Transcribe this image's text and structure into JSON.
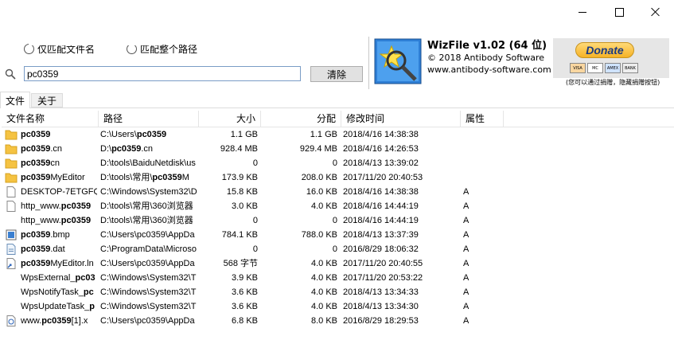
{
  "window": {
    "controls": {
      "minimize": "minimize",
      "maximize": "maximize",
      "close": "close"
    }
  },
  "search": {
    "radio_other": "仅匹配文件名",
    "radio_fullpath": "匹配整个路径",
    "query": "pc0359",
    "clear_label": "清除"
  },
  "app": {
    "title": "WizFile v1.02 (64 位)",
    "copyright": "© 2018 Antibody Software",
    "website": "www.antibody-software.com"
  },
  "donate": {
    "label": "Donate",
    "cards": [
      "VISA",
      "MC",
      "AMEX",
      "BANK"
    ],
    "note": "(您可以通过捐赠，隐藏捐赠按钮)"
  },
  "tabs": [
    {
      "label": "文件"
    },
    {
      "label": "关于"
    }
  ],
  "columns": {
    "name": "文件名称",
    "path": "路径",
    "size": "大小",
    "alloc": "分配",
    "modified": "修改时间",
    "attr": "属性"
  },
  "rows": [
    {
      "icon": "folder",
      "name_hl": "pc0359",
      "name_rest": "",
      "path_pre": "C:\\Users\\",
      "path_hl": "pc0359",
      "path_rest": "",
      "size": "1.1 GB",
      "alloc": "1.1 GB",
      "modified": "2018/4/16 14:38:38",
      "attr": ""
    },
    {
      "icon": "folder",
      "name_hl": "pc0359",
      "name_rest": ".cn",
      "path_pre": "D:\\",
      "path_hl": "pc0359",
      "path_rest": ".cn",
      "size": "928.4 MB",
      "alloc": "929.4 MB",
      "modified": "2018/4/16 14:26:53",
      "attr": ""
    },
    {
      "icon": "folder",
      "name_hl": "pc0359",
      "name_rest": "cn",
      "path_pre": "D:\\tools\\BaiduNetdisk\\us",
      "path_hl": "",
      "path_rest": "",
      "size": "0",
      "alloc": "0",
      "modified": "2018/4/13 13:39:02",
      "attr": ""
    },
    {
      "icon": "folder",
      "name_hl": "pc0359",
      "name_rest": "MyEditor",
      "path_pre": "D:\\tools\\常用\\",
      "path_hl": "pc0359",
      "path_rest": "M",
      "size": "173.9 KB",
      "alloc": "208.0 KB",
      "modified": "2017/11/20 20:40:53",
      "attr": ""
    },
    {
      "icon": "doc",
      "name_hl": "",
      "name_rest": "DESKTOP-7ETGFQH",
      "path_pre": "C:\\Windows\\System32\\D",
      "path_hl": "",
      "path_rest": "",
      "size": "15.8 KB",
      "alloc": "16.0 KB",
      "modified": "2018/4/16 14:38:38",
      "attr": "A"
    },
    {
      "icon": "doc",
      "name_hl": "pc0359",
      "name_rest": "",
      "name_pre": "http_www.",
      "path_pre": "D:\\tools\\常用\\360浏览器",
      "path_hl": "",
      "path_rest": "",
      "size": "3.0 KB",
      "alloc": "4.0 KB",
      "modified": "2018/4/16 14:44:19",
      "attr": "A"
    },
    {
      "icon": "none",
      "name_hl": "pc0359",
      "name_rest": "",
      "name_pre": "http_www.",
      "path_pre": "D:\\tools\\常用\\360浏览器",
      "path_hl": "",
      "path_rest": "",
      "size": "0",
      "alloc": "0",
      "modified": "2018/4/16 14:44:19",
      "attr": "A"
    },
    {
      "icon": "image",
      "name_hl": "pc0359",
      "name_rest": ".bmp",
      "path_pre": "C:\\Users\\pc0359\\AppDa",
      "path_hl": "",
      "path_rest": "",
      "size": "784.1 KB",
      "alloc": "788.0 KB",
      "modified": "2018/4/13 13:37:39",
      "attr": "A"
    },
    {
      "icon": "data",
      "name_hl": "pc0359",
      "name_rest": ".dat",
      "path_pre": "C:\\ProgramData\\Microso",
      "path_hl": "",
      "path_rest": "",
      "size": "0",
      "alloc": "0",
      "modified": "2016/8/29 18:06:32",
      "attr": "A"
    },
    {
      "icon": "link",
      "name_hl": "pc0359",
      "name_rest": "MyEditor.ln",
      "path_pre": "C:\\Users\\pc0359\\AppDa",
      "path_hl": "",
      "path_rest": "",
      "size": "568 字节",
      "alloc": "4.0 KB",
      "modified": "2017/11/20 20:40:55",
      "attr": "A"
    },
    {
      "icon": "none",
      "name_hl": "pc03",
      "name_rest": "",
      "name_pre": "WpsExternal_",
      "path_pre": "C:\\Windows\\System32\\T",
      "path_hl": "",
      "path_rest": "",
      "size": "3.9 KB",
      "alloc": "4.0 KB",
      "modified": "2017/11/20 20:53:22",
      "attr": "A"
    },
    {
      "icon": "none",
      "name_hl": "pc",
      "name_rest": "",
      "name_pre": "WpsNotifyTask_",
      "path_pre": "C:\\Windows\\System32\\T",
      "path_hl": "",
      "path_rest": "",
      "size": "3.6 KB",
      "alloc": "4.0 KB",
      "modified": "2018/4/13 13:34:33",
      "attr": "A"
    },
    {
      "icon": "none",
      "name_hl": "p",
      "name_rest": "",
      "name_pre": "WpsUpdateTask_",
      "path_pre": "C:\\Windows\\System32\\T",
      "path_hl": "",
      "path_rest": "",
      "size": "3.6 KB",
      "alloc": "4.0 KB",
      "modified": "2018/4/13 13:34:30",
      "attr": "A"
    },
    {
      "icon": "web",
      "name_hl": "pc0359",
      "name_rest": "[1].x",
      "name_pre": "www.",
      "path_pre": "C:\\Users\\pc0359\\AppDa",
      "path_hl": "",
      "path_rest": "",
      "size": "6.8 KB",
      "alloc": "8.0 KB",
      "modified": "2016/8/29 18:29:53",
      "attr": "A"
    }
  ],
  "colors": {
    "folder": "#f5c342",
    "highlight_text": "#000000",
    "input_border": "#7a9cc6",
    "donate": "#f6b226"
  }
}
